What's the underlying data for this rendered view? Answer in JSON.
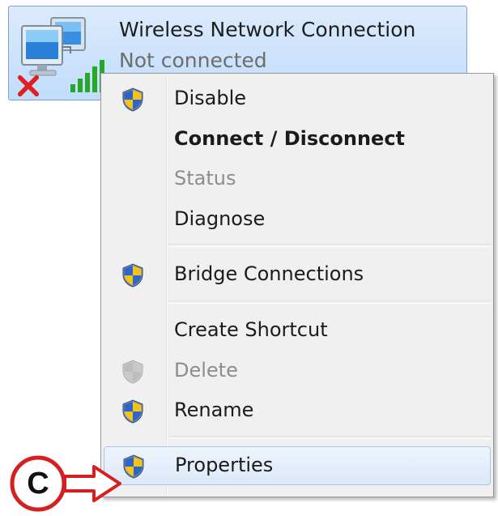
{
  "connection": {
    "title": "Wireless Network Connection",
    "status": "Not connected",
    "icon": "wireless-network-adapter-icon",
    "status_icon": "red-x-icon"
  },
  "context_menu": {
    "items": [
      {
        "label": "Disable",
        "bold": false,
        "disabled": false,
        "shield": true
      },
      {
        "label": "Connect / Disconnect",
        "bold": true,
        "disabled": false,
        "shield": false
      },
      {
        "label": "Status",
        "bold": false,
        "disabled": true,
        "shield": false
      },
      {
        "label": "Diagnose",
        "bold": false,
        "disabled": false,
        "shield": false
      },
      {
        "label": "Bridge Connections",
        "bold": false,
        "disabled": false,
        "shield": true
      },
      {
        "label": "Create Shortcut",
        "bold": false,
        "disabled": false,
        "shield": false
      },
      {
        "label": "Delete",
        "bold": false,
        "disabled": true,
        "shield": true
      },
      {
        "label": "Rename",
        "bold": false,
        "disabled": false,
        "shield": true
      },
      {
        "label": "Properties",
        "bold": false,
        "disabled": false,
        "shield": true,
        "highlighted": true
      }
    ]
  },
  "callout": {
    "letter": "C",
    "color": "#d42020"
  },
  "colors": {
    "tile_border": "#7da2ce",
    "menu_background": "#f0f0f0",
    "shield_blue": "#2f64c8",
    "shield_yellow": "#f2c318"
  }
}
